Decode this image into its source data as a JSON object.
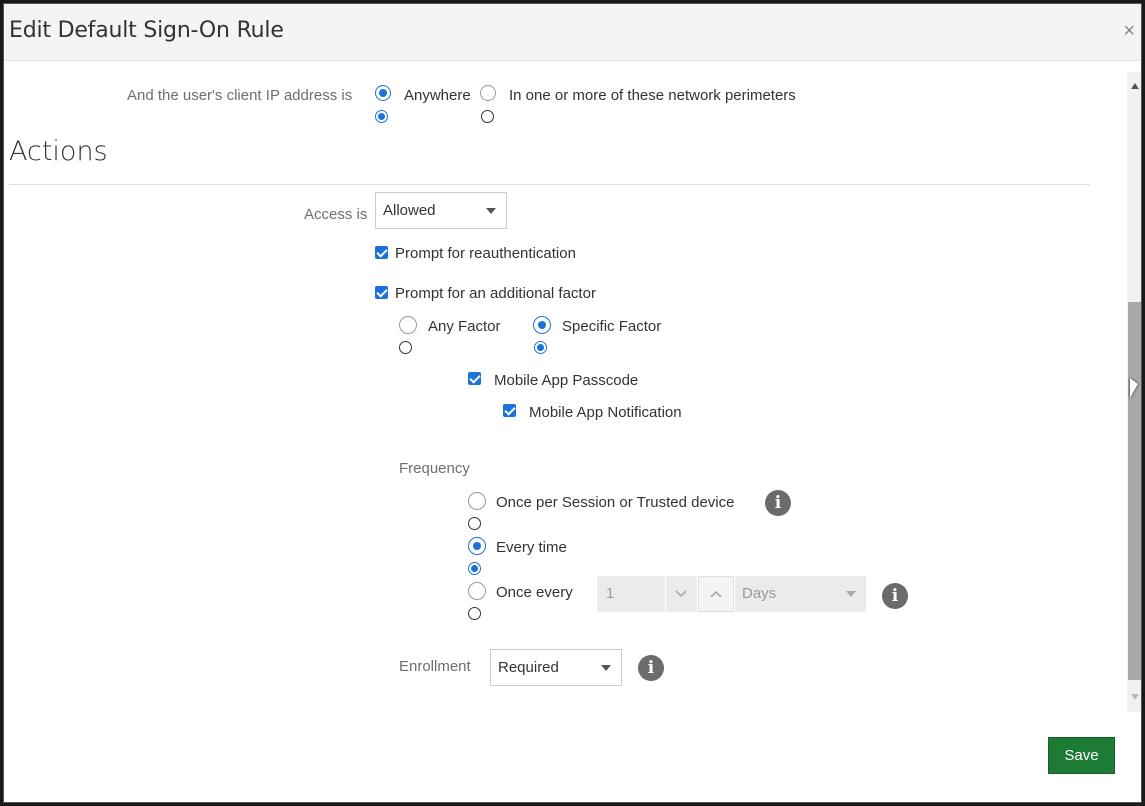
{
  "dialog": {
    "title": "Edit Default Sign-On Rule",
    "close_glyph": "×"
  },
  "conditions": {
    "ip_label": "And the user's client IP address is",
    "ip_options": [
      {
        "label": "Anywhere",
        "selected": true
      },
      {
        "label": "In one or more of these network perimeters",
        "selected": false
      }
    ]
  },
  "actions": {
    "heading": "Actions",
    "access_label": "Access is",
    "access_value": "Allowed",
    "reauth_label": "Prompt for reauthentication",
    "reauth_checked": true,
    "additional_factor_label": "Prompt for an additional factor",
    "additional_factor_checked": true,
    "factor_options": [
      {
        "label": "Any Factor",
        "selected": false
      },
      {
        "label": "Specific Factor",
        "selected": true
      }
    ],
    "factors": [
      {
        "label": "Mobile App Passcode",
        "checked": true
      },
      {
        "label": "Mobile App Notification",
        "checked": true
      }
    ],
    "frequency_label": "Frequency",
    "frequency_options": [
      {
        "label": "Once per Session or Trusted device",
        "selected": false
      },
      {
        "label": "Every time",
        "selected": true
      },
      {
        "label": "Once every",
        "selected": false
      }
    ],
    "once_every_value": "1",
    "once_every_unit": "Days",
    "enrollment_label": "Enrollment",
    "enrollment_value": "Required"
  },
  "footer": {
    "save_label": "Save"
  },
  "icons": {
    "info_glyph": "i"
  },
  "colors": {
    "accent": "#1a73d9",
    "save_button": "#1e7b36"
  }
}
